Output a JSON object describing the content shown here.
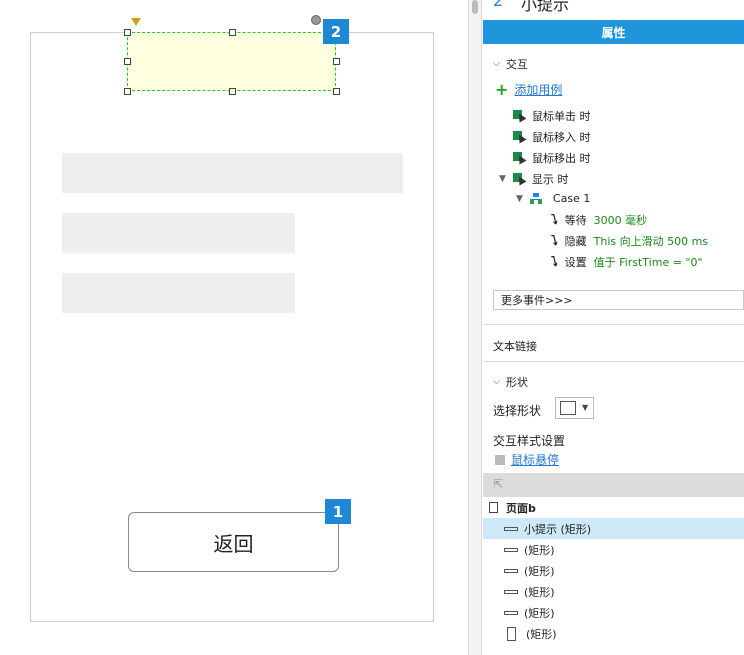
{
  "canvas": {
    "badge_tip": "2",
    "badge_back": "1",
    "back_button_label": "返回"
  },
  "panel": {
    "widget_number": "2",
    "widget_name": "小提示",
    "tab_label": "属性",
    "interaction_section": "交互",
    "add_case_label": "添加用例",
    "events": [
      {
        "label": "鼠标单击 时"
      },
      {
        "label": "鼠标移入 时"
      },
      {
        "label": "鼠标移出 时"
      },
      {
        "label": "显示 时"
      }
    ],
    "case_label": "Case 1",
    "actions": [
      {
        "name": "等待",
        "detail": "3000 毫秒"
      },
      {
        "name": "隐藏",
        "detail": "This 向上滑动 500 ms"
      },
      {
        "name": "设置",
        "detail": "值于 FirstTime = \"0\""
      }
    ],
    "more_events_label": "更多事件>>>",
    "text_link_label": "文本链接",
    "shape_section": "形状",
    "select_shape_label": "选择形状",
    "interaction_style_label": "交互样式设置",
    "hover_link": "鼠标悬停"
  },
  "outline": {
    "page_name": "页面b",
    "items": [
      {
        "label": "小提示 (矩形)"
      },
      {
        "label": "(矩形)"
      },
      {
        "label": "(矩形)"
      },
      {
        "label": "(矩形)"
      },
      {
        "label": "(矩形)"
      },
      {
        "label": "(矩形)"
      }
    ]
  },
  "colors": {
    "accent": "#1f96dc",
    "badge": "#1f88d4",
    "selected_row": "#cde8f7",
    "tip_fill": "#ffffe0",
    "action_detail": "#1a8a1a"
  }
}
